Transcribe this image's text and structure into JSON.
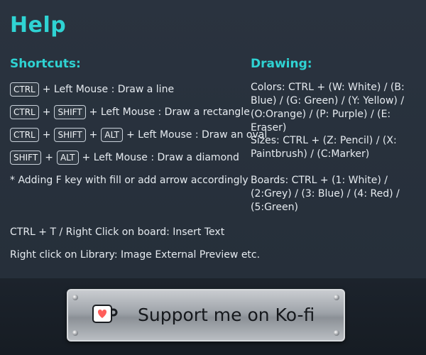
{
  "title": "Help",
  "shortcuts": {
    "heading": "Shortcuts:",
    "items": [
      {
        "keys": [
          "CTRL"
        ],
        "action": "+ Left Mouse : Draw a line"
      },
      {
        "keys": [
          "CTRL",
          "SHIFT"
        ],
        "action": "+ Left Mouse : Draw a rectangle"
      },
      {
        "keys": [
          "CTRL",
          "SHIFT",
          "ALT"
        ],
        "action": "+ Left Mouse : Draw an oval"
      },
      {
        "keys": [
          "SHIFT",
          "ALT"
        ],
        "action": "+ Left Mouse : Draw a diamond"
      }
    ],
    "fill_note": "* Adding F key with fill or add arrow accordingly",
    "insert_text": "CTRL + T / Right Click on board: Insert Text",
    "library_note": "Right click on Library: Image External Preview etc."
  },
  "drawing": {
    "heading": "Drawing:",
    "colors": "Colors: CTRL + (W: White) / (B: Blue) / (G: Green) / (Y: Yellow) / (O:Orange) / (P: Purple) / (E: Eraser)",
    "sizes": "Sizes: CTRL + (Z: Pencil) / (X: Paintbrush) / (C:Marker)",
    "boards": "Boards: CTRL + (1: White) / (2:Grey) / (3: Blue) / (4: Red) / (5:Green)"
  },
  "kofi": {
    "label": "Support me on Ko-fi",
    "icon": "kofi-cup-icon"
  },
  "colors": {
    "accent": "#2fd3d3",
    "panel": "#28313c",
    "text": "#e6ebf0",
    "heart": "#ff5e5b"
  }
}
